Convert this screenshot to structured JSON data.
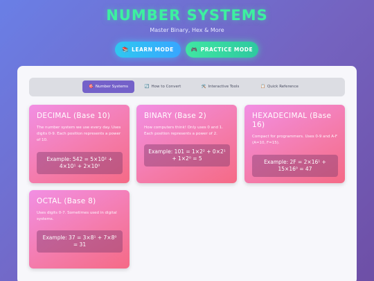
{
  "header": {
    "title": "NUMBER SYSTEMS",
    "subtitle": "Master Binary, Hex & More"
  },
  "modes": {
    "learn": {
      "icon": "📚",
      "label": "LEARN MODE"
    },
    "practice": {
      "icon": "🎮",
      "label": "PRACTICE MODE"
    }
  },
  "tabs": [
    {
      "icon": "🎯",
      "label": "Number Systems"
    },
    {
      "icon": "🔄",
      "label": "How to Convert"
    },
    {
      "icon": "🛠️",
      "label": "Interactive Tools"
    },
    {
      "icon": "📋",
      "label": "Quick Reference"
    }
  ],
  "cards": [
    {
      "title": "DECIMAL (Base 10)",
      "description": "The number system we use every day. Uses digits 0-9. Each position represents a power of 10.",
      "example": "Example: 542 = 5×10² + 4×10¹ + 2×10⁰"
    },
    {
      "title": "BINARY (Base 2)",
      "description": "How computers think! Only uses 0 and 1. Each position represents a power of 2.",
      "example": "Example: 101 = 1×2² + 0×2¹ + 1×2⁰ = 5"
    },
    {
      "title": "HEXADECIMAL (Base 16)",
      "description": "Compact for programmers. Uses 0-9 and A-F (A=10, F=15).",
      "example": "Example: 2F = 2×16¹ + 15×16⁰ = 47"
    },
    {
      "title": "OCTAL (Base 8)",
      "description": "Uses digits 0-7. Sometimes used in digital systems.",
      "example": "Example: 37 = 3×8¹ + 7×8⁰ = 31"
    }
  ]
}
